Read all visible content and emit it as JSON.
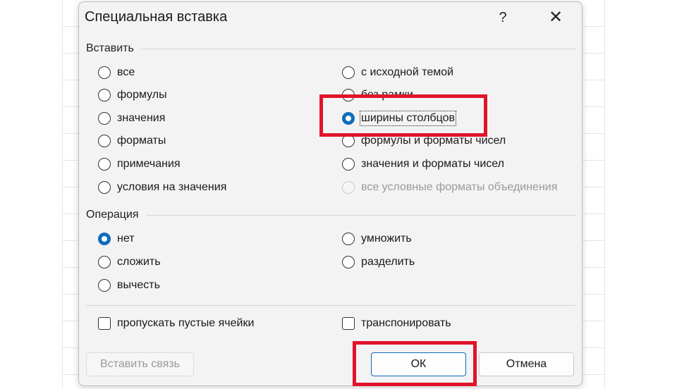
{
  "dialog": {
    "title": "Специальная вставка",
    "help_label": "?",
    "close_label": "✕"
  },
  "paste_group": {
    "label": "Вставить",
    "left_options": [
      {
        "label": "все",
        "checked": false
      },
      {
        "label": "формулы",
        "checked": false
      },
      {
        "label": "значения",
        "checked": false
      },
      {
        "label": "форматы",
        "checked": false
      },
      {
        "label": "примечания",
        "checked": false
      },
      {
        "label": "условия на значения",
        "checked": false
      }
    ],
    "right_options": [
      {
        "label": "с исходной темой",
        "checked": false
      },
      {
        "label": "без рамки",
        "checked": false
      },
      {
        "label": "ширины столбцов",
        "checked": true
      },
      {
        "label": "формулы и форматы чисел",
        "checked": false
      },
      {
        "label": "значения и форматы чисел",
        "checked": false
      },
      {
        "label": "все условные форматы объединения",
        "checked": false,
        "disabled": true
      }
    ]
  },
  "operation_group": {
    "label": "Операция",
    "left_options": [
      {
        "label": "нет",
        "checked": true
      },
      {
        "label": "сложить",
        "checked": false
      },
      {
        "label": "вычесть",
        "checked": false
      }
    ],
    "right_options": [
      {
        "label": "умножить",
        "checked": false
      },
      {
        "label": "разделить",
        "checked": false
      }
    ]
  },
  "checkboxes": {
    "skip_blanks": "пропускать пустые ячейки",
    "transpose": "транспонировать"
  },
  "buttons": {
    "paste_link": "Вставить связь",
    "ok": "ОК",
    "cancel": "Отмена"
  },
  "colors": {
    "accent": "#0f6cbd",
    "highlight": "#e0142a",
    "dialog_bg": "#f3f3f3"
  }
}
